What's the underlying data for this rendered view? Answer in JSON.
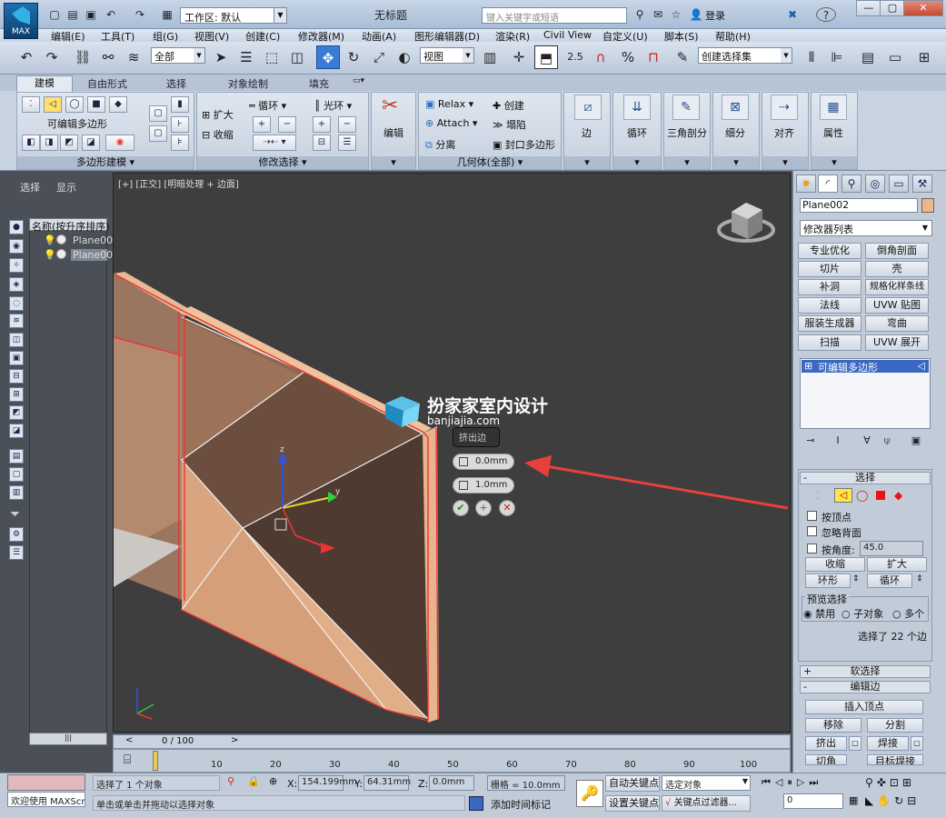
{
  "app": {
    "title": "无标题",
    "logo_label": "MAX",
    "workspace": "工作区: 默认",
    "search_placeholder": "键入关键字或短语",
    "login": "登录",
    "help": "?"
  },
  "menus": [
    "编辑(E)",
    "工具(T)",
    "组(G)",
    "视图(V)",
    "创建(C)",
    "修改器(M)",
    "动画(A)",
    "图形编辑器(D)",
    "渲染(R)",
    "Civil View",
    "自定义(U)",
    "脚本(S)",
    "帮助(H)"
  ],
  "toolbar": {
    "selection_filter": "全部",
    "ref_coord": "视图",
    "named_selection": "创建选择集",
    "snap_angle": "2.5",
    "percent_snap": "%"
  },
  "ribbon": {
    "tabs": [
      "建模",
      "自由形式",
      "选择",
      "对象绘制",
      "填充"
    ],
    "active_tab": "建模",
    "polymodel_label": "可编辑多边形",
    "polymodel_footer": "多边形建模",
    "grow": "扩大",
    "shrink": "收缩",
    "loop": "循环",
    "ring": "光环",
    "modsel_footer": "修改选择",
    "edit": "编辑",
    "relax": "Relax",
    "attach": "Attach",
    "detach": "分离",
    "create": "创建",
    "collapse": "塌陷",
    "cap_poly": "封口多边形",
    "geom_footer": "几何体(全部)",
    "edge": "边",
    "loops": "循环",
    "tri": "三角剖分",
    "subdiv": "细分",
    "align": "对齐",
    "props": "属性"
  },
  "scene_explorer": {
    "tab_select": "选择",
    "tab_display": "显示",
    "header": "名称(按升序排序)",
    "items": [
      "Plane00",
      "Plane00"
    ]
  },
  "viewport": {
    "label": "[+] [正交] [明暗处理 + 边面]",
    "watermark_title": "扮家家室内设计",
    "watermark_url": "banjiajia.com",
    "caddy_title": "挤出边",
    "caddy_height": "0.0mm",
    "caddy_width": "1.0mm",
    "ok": "✔",
    "apply": "+",
    "cancel": "✕"
  },
  "timeline": {
    "slider": "0 / 100",
    "ticks": [
      "10",
      "20",
      "30",
      "40",
      "50",
      "60",
      "70",
      "80",
      "90",
      "100"
    ]
  },
  "command_panel": {
    "object_name": "Plane002",
    "modifier_list": "修改器列表",
    "modifier_buttons": [
      "专业优化",
      "倒角剖面",
      "切片",
      "壳",
      "补洞",
      "规格化样条线",
      "法线",
      "UVW 贴图",
      "服装生成器",
      "弯曲",
      "扫描",
      "UVW 展开"
    ],
    "stack_item": "可编辑多边形",
    "rollout_select": "选择",
    "by_vertex": "按顶点",
    "ignore_backface": "忽略背面",
    "by_angle": "按角度:",
    "angle_value": "45.0",
    "shrink": "收缩",
    "grow": "扩大",
    "ring": "环形",
    "loop": "循环",
    "preview_select": "预览选择",
    "disabled": "禁用",
    "sub_object": "子对象",
    "multiple": "多个",
    "selected_info": "选择了 22 个边",
    "soft_select": "软选择",
    "edit_edges": "编辑边",
    "insert_vertex": "插入顶点",
    "remove": "移除",
    "split": "分割",
    "extrude": "挤出",
    "weld": "焊接",
    "chamfer": "切角",
    "target_weld": "目标焊接"
  },
  "status": {
    "welcome": "欢迎使用 MAXScr",
    "selected": "选择了 1 个对象",
    "hint": "单击或单击并拖动以选择对象",
    "x_label": "X:",
    "x_value": "154.199mm",
    "y_label": "Y:",
    "y_value": "64.31mm",
    "z_label": "Z:",
    "z_value": "0.0mm",
    "grid": "栅格 = 10.0mm",
    "auto_key": "自动关键点",
    "selected_obj": "选定对象",
    "set_key": "设置关键点",
    "key_filter": "关键点过滤器...",
    "add_time_tag": "添加时间标记",
    "frame": "0"
  },
  "colors": {
    "accent": "#3a67c2",
    "arrow": "#e8413c",
    "face": "#d9a580"
  }
}
